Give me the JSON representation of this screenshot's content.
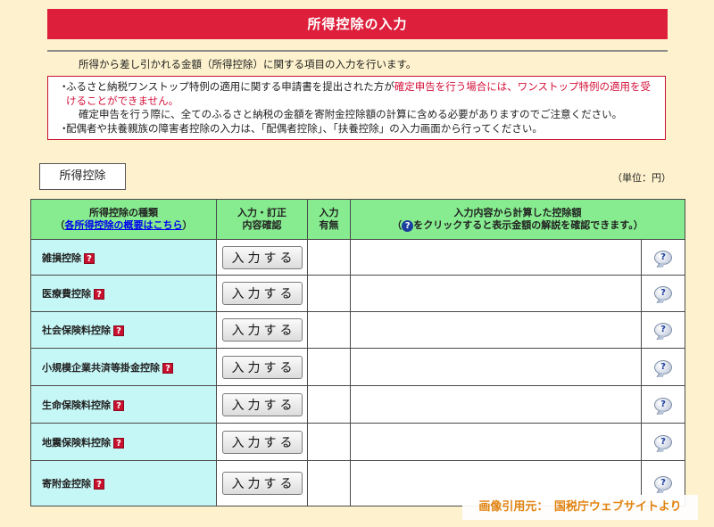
{
  "page": {
    "title": "所得控除の入力",
    "intro": "所得から差し引かれる金額（所得控除）に関する項目の入力を行います。"
  },
  "notice": {
    "items": [
      {
        "bullet": "・",
        "text_plain": "ふるさと納税ワンストップ特例の適用に関する申請書を提出された方が",
        "text_red": "確定申告を行う場合には、ワンストップ特例の適用を受けることができません。",
        "text_cont": "確定申告を行う際に、全てのふるさと納税の金額を寄附金控除額の計算に含める必要がありますのでご注意ください。"
      },
      {
        "bullet": "・",
        "text_plain": "配偶者や扶養親族の障害者控除の入力は、「配偶者控除」、「扶養控除」の入力画面から行ってください。"
      }
    ]
  },
  "section": {
    "label": "所得控除",
    "unit": "（単位：円）"
  },
  "table": {
    "headers": {
      "type_line1": "所得控除の種類",
      "type_link_prefix": "（",
      "type_link": "各所得控除の概要はこちら",
      "type_link_suffix": "）",
      "entry_line1": "入力・訂正",
      "entry_line2": "内容確認",
      "has_line1": "入力",
      "has_line2": "有無",
      "calc_line1": "入力内容から計算した控除額",
      "calc_line2_pre": "（",
      "calc_q": "?",
      "calc_line2_post": "をクリックすると表示金額の解説を確認できます。）"
    },
    "help_glyph": "?",
    "enter_label": "入力する",
    "rows": [
      {
        "name": "雑損控除",
        "has": "",
        "amount": ""
      },
      {
        "name": "医療費控除",
        "has": "",
        "amount": ""
      },
      {
        "name": "社会保険料控除",
        "has": "",
        "amount": ""
      },
      {
        "name": "小規模企業共済等掛金控除",
        "has": "",
        "amount": ""
      },
      {
        "name": "生命保険料控除",
        "has": "",
        "amount": ""
      },
      {
        "name": "地震保険料控除",
        "has": "",
        "amount": ""
      },
      {
        "name": "寄附金控除",
        "has": "",
        "amount": ""
      }
    ]
  },
  "credit": "画像引用元：　国税庁ウェブサイトより",
  "colors": {
    "title_bg": "#dd1f3c",
    "header_bg": "#86ec8f",
    "name_bg": "#c6f7f7",
    "page_bg": "#fdf2cd",
    "notice_red": "#d4123a",
    "credit_text": "#e07b00"
  }
}
